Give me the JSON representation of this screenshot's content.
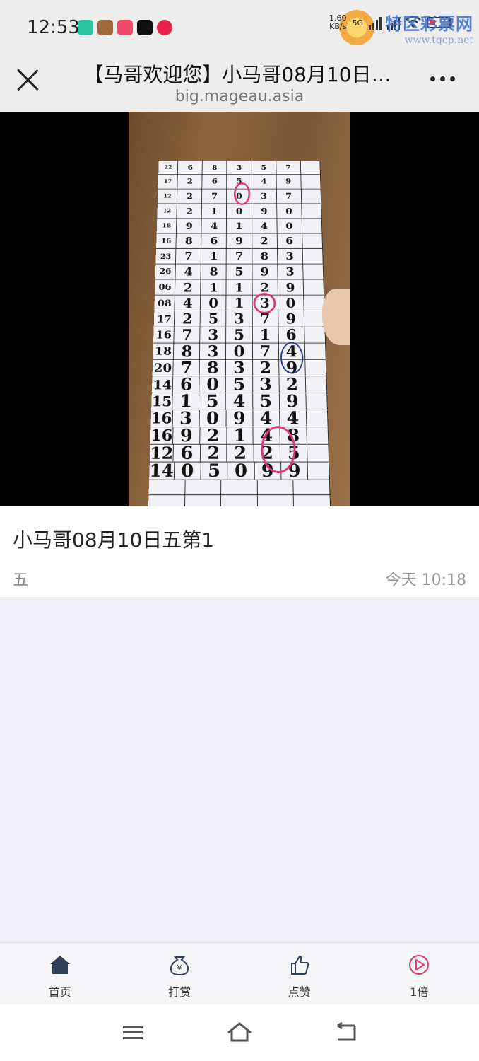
{
  "status_bar": {
    "time": "12:53",
    "net_speed_value": "1.60",
    "net_speed_unit": "KB/s",
    "network_type": "5G",
    "watermark_text": "特区彩票网",
    "watermark_url": "www.tqcp.net"
  },
  "nav": {
    "title": "【马哥欢迎您】小马哥08月10日…",
    "url": "big.mageau.asia"
  },
  "post": {
    "title": "小马哥08月10日五第1",
    "tag": "五",
    "time": "今天 10:18"
  },
  "bottom_tabs": [
    {
      "label": "首页",
      "icon": "home-icon"
    },
    {
      "label": "打赏",
      "icon": "reward-icon"
    },
    {
      "label": "点赞",
      "icon": "thumbs-up-icon"
    },
    {
      "label": "1倍",
      "icon": "playback-speed-icon"
    }
  ],
  "video_grid": {
    "rows": [
      [
        "6",
        "8",
        "3",
        "5",
        "7"
      ],
      [
        "2",
        "6",
        "5",
        "4",
        "9"
      ],
      [
        "2",
        "7",
        "0",
        "3",
        "7"
      ],
      [
        "2",
        "1",
        "0",
        "9",
        "0"
      ],
      [
        "9",
        "4",
        "1",
        "4",
        "0"
      ],
      [
        "8",
        "6",
        "9",
        "2",
        "6"
      ],
      [
        "7",
        "1",
        "7",
        "8",
        "3"
      ],
      [
        "4",
        "8",
        "5",
        "9",
        "3"
      ],
      [
        "2",
        "1",
        "1",
        "2",
        "9"
      ],
      [
        "4",
        "0",
        "1",
        "3",
        "0"
      ],
      [
        "2",
        "5",
        "3",
        "7",
        "9"
      ],
      [
        "7",
        "3",
        "5",
        "1",
        "6"
      ],
      [
        "8",
        "3",
        "0",
        "7",
        "4"
      ],
      [
        "7",
        "8",
        "3",
        "2",
        "9"
      ],
      [
        "6",
        "0",
        "5",
        "3",
        "2"
      ],
      [
        "1",
        "5",
        "4",
        "5",
        "9"
      ],
      [
        "3",
        "0",
        "9",
        "4",
        "4"
      ],
      [
        "9",
        "2",
        "1",
        "4",
        "8"
      ],
      [
        "6",
        "2",
        "2",
        "2",
        "5"
      ],
      [
        "0",
        "5",
        "0",
        "9",
        "9"
      ]
    ],
    "row_labels": [
      "22",
      "17",
      "12",
      "12",
      "18",
      "16",
      "23",
      "26",
      "06",
      "08",
      "17",
      "16",
      "18",
      "20",
      "14",
      "15",
      "16",
      "16",
      "12",
      "14"
    ]
  },
  "colors": {
    "status_bg": "#ededed",
    "page_bg": "#f0f0f6",
    "pen_red": "#e0357a",
    "accent_red": "#e0386a",
    "icon_dark": "#2f3d55"
  }
}
